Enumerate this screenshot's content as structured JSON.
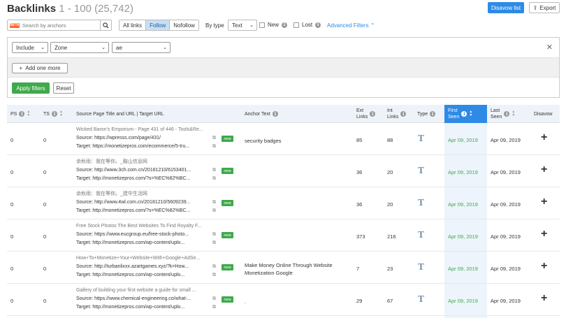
{
  "header": {
    "title": "Backlinks",
    "count": "1 - 100 (25,742)",
    "disavow_label": "Disavow list",
    "export_label": "Export"
  },
  "toolbar": {
    "search_tag": "BETA",
    "search_placeholder": "Search by anchors",
    "segments": [
      "All links",
      "Follow",
      "Nofollow"
    ],
    "active_segment": "Follow",
    "bytype_label": "By type",
    "type_value": "Text",
    "new_label": "New",
    "lost_label": "Lost",
    "advanced_filters_label": "Advanced Filters"
  },
  "filters": {
    "include_value": "Include",
    "zone_value": "Zone",
    "zone_text": "ae",
    "add_more_label": "Add one more",
    "apply_label": "Apply filters",
    "reset_label": "Reset"
  },
  "columns": {
    "ps": "PS",
    "ts": "TS",
    "source": "Source Page Title and URL | Target URL",
    "anchor": "Anchor Text",
    "ext_line1": "Ext",
    "ext_line2": "Links",
    "int_line1": "Int",
    "int_line2": "Links",
    "type": "Type",
    "first_line1": "First",
    "first_line2": "Seen",
    "last_line1": "Last",
    "last_line2": "Seen",
    "disavow": "Disavow"
  },
  "rows": [
    {
      "ps": "0",
      "ts": "0",
      "title": "Wicked Baron's Emporium - Page 431 of 446 - Tools&Re...",
      "source": "Source: https://wpresss.com/page/431/",
      "target": "Target: https://monetizepros.com/ecommerce/5-tru...",
      "badge": "new",
      "anchor1": "security badges",
      "anchor2": "",
      "ext": "85",
      "int": "88",
      "first": "Apr 09, 2019",
      "last": "Apr 09, 2019"
    },
    {
      "ps": "0",
      "ts": "0",
      "title": "余秋雨：我在等你。_鞍山信息网",
      "source": "Source: http://www.3ch.com.cn/20181210/6153401...",
      "target": "Target: http://monetizepros.com/?s=%EC%82%BC...",
      "badge": "new",
      "anchor1": "",
      "anchor2": "",
      "ext": "36",
      "int": "20",
      "first": "Apr 09, 2019",
      "last": "Apr 09, 2019"
    },
    {
      "ps": "0",
      "ts": "0",
      "title": "余秋雨：我在等你。_建华生活网",
      "source": "Source: http://www.4wl.com.cn/20181210/5609239...",
      "target": "Target: http://monetizepros.com/?s=%EC%82%BC...",
      "badge": "new",
      "anchor1": "",
      "anchor2": "",
      "ext": "36",
      "int": "20",
      "first": "Apr 09, 2019",
      "last": "Apr 09, 2019"
    },
    {
      "ps": "0",
      "ts": "0",
      "title": "Free Stock Photos The Best Websites To Find Royalty F...",
      "source": "Source: https://www.eucgroup.eu/free-stock-photo...",
      "target": "Target: http://monetizepros.com/wp-content/uplo...",
      "badge": "new",
      "anchor1": "",
      "anchor2": "",
      "ext": "373",
      "int": "216",
      "first": "Apr 09, 2019",
      "last": "Apr 09, 2019"
    },
    {
      "ps": "0",
      "ts": "0",
      "title": "How+To+Monetize+Your+Website+With+Google+AdSe...",
      "source": "Source: http://turbanlixxx.azartgames.xyz/?k=How...",
      "target": "Target: http://monetizepros.com/wp-content/uplo...",
      "badge": "new",
      "anchor1": "Make Money Online Through Website",
      "anchor2": "Monetization Google",
      "ext": "7",
      "int": "23",
      "first": "Apr 09, 2019",
      "last": "Apr 09, 2019"
    },
    {
      "ps": "0",
      "ts": "0",
      "title": "Gallery of building your first website a guide for small ...",
      "source": "Source: https://www.chemical-engineering.co/what-...",
      "target": "Target: http://monetizepros.com/wp-content/uplo...",
      "badge": "new",
      "anchor1": ".",
      "anchor2": "",
      "ext": "29",
      "int": "67",
      "first": "Apr 09, 2019",
      "last": "Apr 09, 2019"
    }
  ]
}
